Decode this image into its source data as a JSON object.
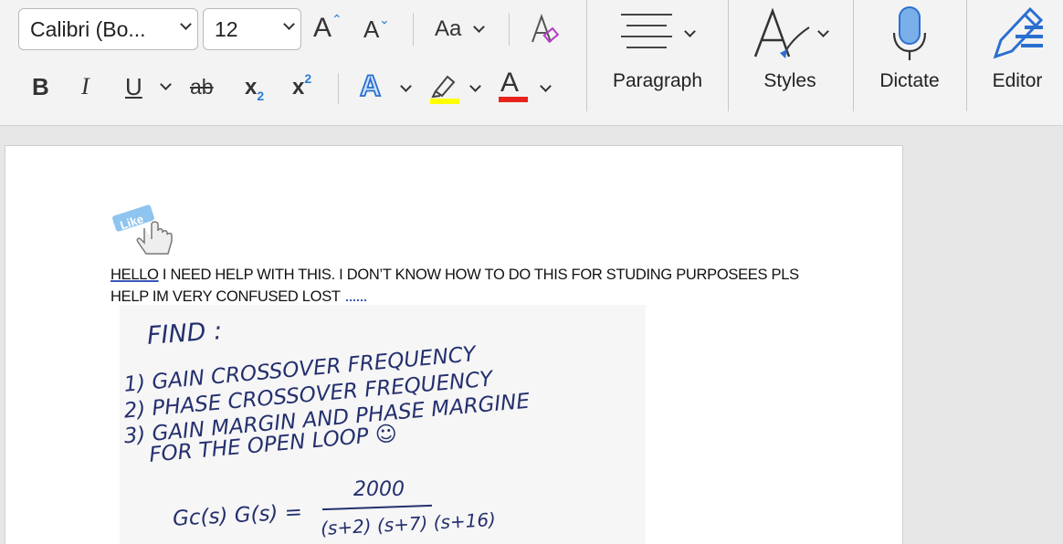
{
  "ribbon": {
    "font_name": "Calibri (Bo...",
    "font_size": "12",
    "grow_label": "A",
    "shrink_label": "A",
    "change_case_label": "Aa",
    "bold_label": "B",
    "italic_label": "I",
    "underline_label": "U",
    "strike_label": "ab",
    "subscript_label": "x",
    "subscript_mark": "2",
    "superscript_label": "x",
    "superscript_mark": "2",
    "text_effects_label": "A",
    "font_color_label": "A",
    "paragraph_label": "Paragraph",
    "styles_label": "Styles",
    "dictate_label": "Dictate",
    "editor_label": "Editor",
    "highlight_color": "#ffff00",
    "font_color": "#e8231e"
  },
  "document": {
    "like_sticker": "Like",
    "text_word1": "HELLO",
    "text_rest": " I NEED HELP WITH THIS. I DON’T KNOW HOW TO DO THIS FOR STUDING PURPOSEES PLS HELP IM VERY CONFUSED LOST",
    "handwriting": {
      "line0": "FIND :",
      "line1": "1) GAIN  CROSSOVER  FREQUENCY",
      "line2": "2) PHASE CROSSOVER FREQUENCY",
      "line3a": "3) GAIN  MARGIN  AND  PHASE  MARGINE",
      "line4": "FOR  THE  OPEN  LOOP ☺",
      "eq_lhs": "Gc(s) G(s) =",
      "eq_num": "2000",
      "eq_den": "(s+2) (s+7) (s+16)"
    }
  }
}
